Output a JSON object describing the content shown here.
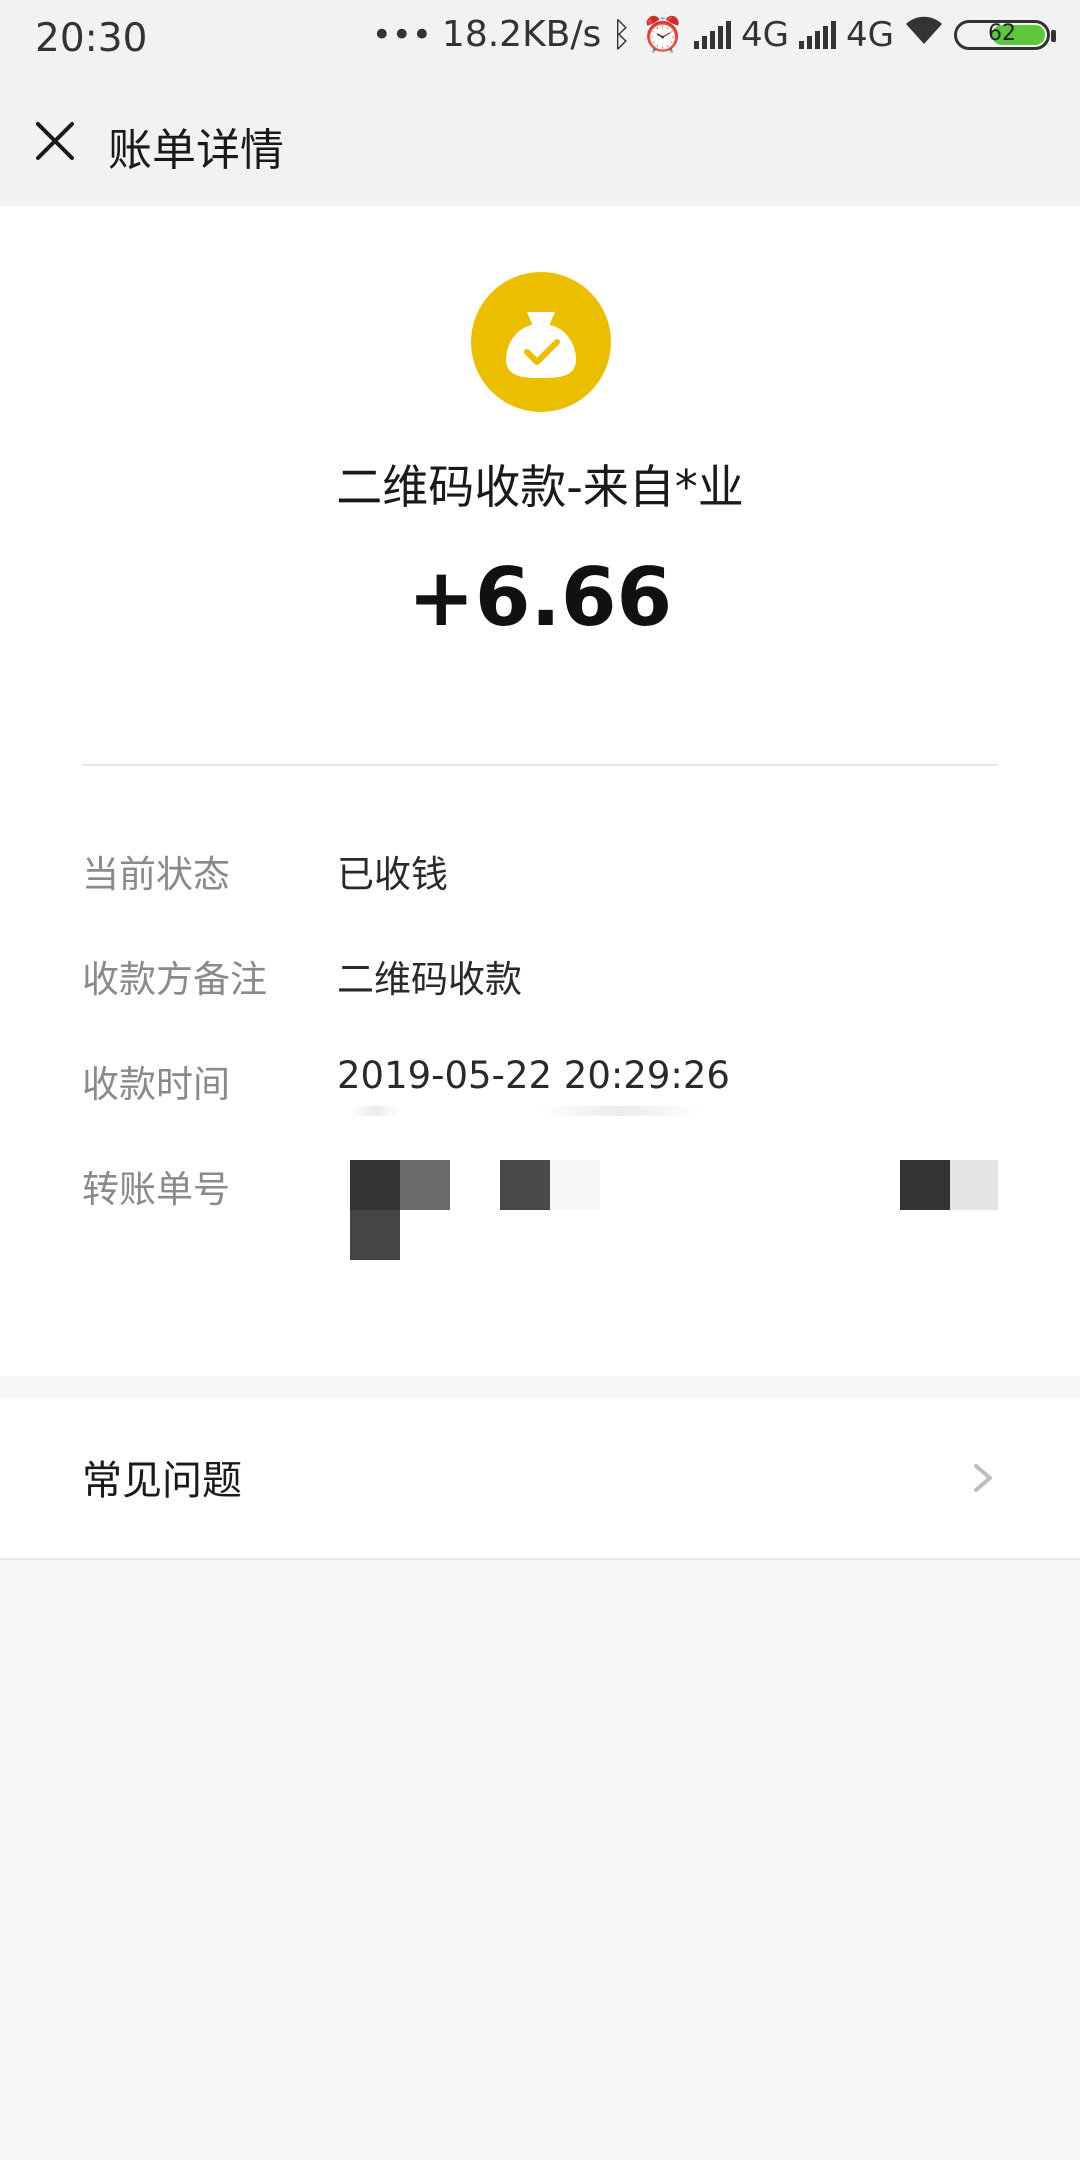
{
  "status_bar": {
    "time": "20:30",
    "network_speed": "18.2KB/s",
    "network_type_1": "4G",
    "network_type_2": "4G",
    "battery_percent": 62,
    "battery_text": "62",
    "icons": [
      "dots-icon",
      "bluetooth-icon",
      "alarm-icon",
      "signal-icon",
      "signal-icon",
      "wifi-icon",
      "battery-icon"
    ]
  },
  "header": {
    "title": "账单详情",
    "close_icon": "close-icon"
  },
  "summary": {
    "icon": "money-bag-check-icon",
    "icon_color": "#ebbf00",
    "title": "二维码收款-来自*业",
    "amount": "+6.66"
  },
  "details": [
    {
      "label": "当前状态",
      "value": "已收钱"
    },
    {
      "label": "收款方备注",
      "value": "二维码收款"
    },
    {
      "label": "收款时间",
      "value": "2019-05-22 20:29:26"
    },
    {
      "label": "转账单号",
      "value": ""
    }
  ],
  "faq": {
    "label": "常见问题",
    "chevron_icon": "chevron-right-icon"
  }
}
